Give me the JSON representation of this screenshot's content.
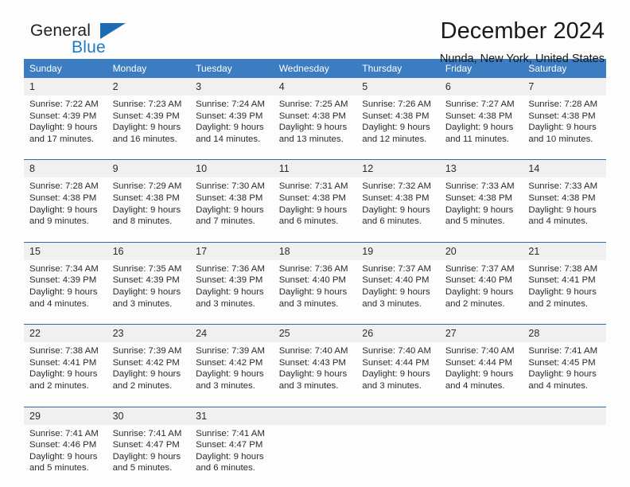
{
  "brand": {
    "name_part1": "General",
    "name_part2": "Blue",
    "flag_icon": "triangle-flag-icon"
  },
  "header": {
    "title": "December 2024",
    "location": "Nunda, New York, United States"
  },
  "colors": {
    "header_blue": "#3b7dc0",
    "separator_blue": "#2d6ca8",
    "daynum_band": "#f0f0f0",
    "brand_blue": "#1f7ac4",
    "text": "#2b2b2b"
  },
  "weekdays": [
    "Sunday",
    "Monday",
    "Tuesday",
    "Wednesday",
    "Thursday",
    "Friday",
    "Saturday"
  ],
  "weeks": [
    [
      {
        "day": "1",
        "sunrise": "Sunrise: 7:22 AM",
        "sunset": "Sunset: 4:39 PM",
        "daylight1": "Daylight: 9 hours",
        "daylight2": "and 17 minutes."
      },
      {
        "day": "2",
        "sunrise": "Sunrise: 7:23 AM",
        "sunset": "Sunset: 4:39 PM",
        "daylight1": "Daylight: 9 hours",
        "daylight2": "and 16 minutes."
      },
      {
        "day": "3",
        "sunrise": "Sunrise: 7:24 AM",
        "sunset": "Sunset: 4:39 PM",
        "daylight1": "Daylight: 9 hours",
        "daylight2": "and 14 minutes."
      },
      {
        "day": "4",
        "sunrise": "Sunrise: 7:25 AM",
        "sunset": "Sunset: 4:38 PM",
        "daylight1": "Daylight: 9 hours",
        "daylight2": "and 13 minutes."
      },
      {
        "day": "5",
        "sunrise": "Sunrise: 7:26 AM",
        "sunset": "Sunset: 4:38 PM",
        "daylight1": "Daylight: 9 hours",
        "daylight2": "and 12 minutes."
      },
      {
        "day": "6",
        "sunrise": "Sunrise: 7:27 AM",
        "sunset": "Sunset: 4:38 PM",
        "daylight1": "Daylight: 9 hours",
        "daylight2": "and 11 minutes."
      },
      {
        "day": "7",
        "sunrise": "Sunrise: 7:28 AM",
        "sunset": "Sunset: 4:38 PM",
        "daylight1": "Daylight: 9 hours",
        "daylight2": "and 10 minutes."
      }
    ],
    [
      {
        "day": "8",
        "sunrise": "Sunrise: 7:28 AM",
        "sunset": "Sunset: 4:38 PM",
        "daylight1": "Daylight: 9 hours",
        "daylight2": "and 9 minutes."
      },
      {
        "day": "9",
        "sunrise": "Sunrise: 7:29 AM",
        "sunset": "Sunset: 4:38 PM",
        "daylight1": "Daylight: 9 hours",
        "daylight2": "and 8 minutes."
      },
      {
        "day": "10",
        "sunrise": "Sunrise: 7:30 AM",
        "sunset": "Sunset: 4:38 PM",
        "daylight1": "Daylight: 9 hours",
        "daylight2": "and 7 minutes."
      },
      {
        "day": "11",
        "sunrise": "Sunrise: 7:31 AM",
        "sunset": "Sunset: 4:38 PM",
        "daylight1": "Daylight: 9 hours",
        "daylight2": "and 6 minutes."
      },
      {
        "day": "12",
        "sunrise": "Sunrise: 7:32 AM",
        "sunset": "Sunset: 4:38 PM",
        "daylight1": "Daylight: 9 hours",
        "daylight2": "and 6 minutes."
      },
      {
        "day": "13",
        "sunrise": "Sunrise: 7:33 AM",
        "sunset": "Sunset: 4:38 PM",
        "daylight1": "Daylight: 9 hours",
        "daylight2": "and 5 minutes."
      },
      {
        "day": "14",
        "sunrise": "Sunrise: 7:33 AM",
        "sunset": "Sunset: 4:38 PM",
        "daylight1": "Daylight: 9 hours",
        "daylight2": "and 4 minutes."
      }
    ],
    [
      {
        "day": "15",
        "sunrise": "Sunrise: 7:34 AM",
        "sunset": "Sunset: 4:39 PM",
        "daylight1": "Daylight: 9 hours",
        "daylight2": "and 4 minutes."
      },
      {
        "day": "16",
        "sunrise": "Sunrise: 7:35 AM",
        "sunset": "Sunset: 4:39 PM",
        "daylight1": "Daylight: 9 hours",
        "daylight2": "and 3 minutes."
      },
      {
        "day": "17",
        "sunrise": "Sunrise: 7:36 AM",
        "sunset": "Sunset: 4:39 PM",
        "daylight1": "Daylight: 9 hours",
        "daylight2": "and 3 minutes."
      },
      {
        "day": "18",
        "sunrise": "Sunrise: 7:36 AM",
        "sunset": "Sunset: 4:40 PM",
        "daylight1": "Daylight: 9 hours",
        "daylight2": "and 3 minutes."
      },
      {
        "day": "19",
        "sunrise": "Sunrise: 7:37 AM",
        "sunset": "Sunset: 4:40 PM",
        "daylight1": "Daylight: 9 hours",
        "daylight2": "and 3 minutes."
      },
      {
        "day": "20",
        "sunrise": "Sunrise: 7:37 AM",
        "sunset": "Sunset: 4:40 PM",
        "daylight1": "Daylight: 9 hours",
        "daylight2": "and 2 minutes."
      },
      {
        "day": "21",
        "sunrise": "Sunrise: 7:38 AM",
        "sunset": "Sunset: 4:41 PM",
        "daylight1": "Daylight: 9 hours",
        "daylight2": "and 2 minutes."
      }
    ],
    [
      {
        "day": "22",
        "sunrise": "Sunrise: 7:38 AM",
        "sunset": "Sunset: 4:41 PM",
        "daylight1": "Daylight: 9 hours",
        "daylight2": "and 2 minutes."
      },
      {
        "day": "23",
        "sunrise": "Sunrise: 7:39 AM",
        "sunset": "Sunset: 4:42 PM",
        "daylight1": "Daylight: 9 hours",
        "daylight2": "and 2 minutes."
      },
      {
        "day": "24",
        "sunrise": "Sunrise: 7:39 AM",
        "sunset": "Sunset: 4:42 PM",
        "daylight1": "Daylight: 9 hours",
        "daylight2": "and 3 minutes."
      },
      {
        "day": "25",
        "sunrise": "Sunrise: 7:40 AM",
        "sunset": "Sunset: 4:43 PM",
        "daylight1": "Daylight: 9 hours",
        "daylight2": "and 3 minutes."
      },
      {
        "day": "26",
        "sunrise": "Sunrise: 7:40 AM",
        "sunset": "Sunset: 4:44 PM",
        "daylight1": "Daylight: 9 hours",
        "daylight2": "and 3 minutes."
      },
      {
        "day": "27",
        "sunrise": "Sunrise: 7:40 AM",
        "sunset": "Sunset: 4:44 PM",
        "daylight1": "Daylight: 9 hours",
        "daylight2": "and 4 minutes."
      },
      {
        "day": "28",
        "sunrise": "Sunrise: 7:41 AM",
        "sunset": "Sunset: 4:45 PM",
        "daylight1": "Daylight: 9 hours",
        "daylight2": "and 4 minutes."
      }
    ],
    [
      {
        "day": "29",
        "sunrise": "Sunrise: 7:41 AM",
        "sunset": "Sunset: 4:46 PM",
        "daylight1": "Daylight: 9 hours",
        "daylight2": "and 5 minutes."
      },
      {
        "day": "30",
        "sunrise": "Sunrise: 7:41 AM",
        "sunset": "Sunset: 4:47 PM",
        "daylight1": "Daylight: 9 hours",
        "daylight2": "and 5 minutes."
      },
      {
        "day": "31",
        "sunrise": "Sunrise: 7:41 AM",
        "sunset": "Sunset: 4:47 PM",
        "daylight1": "Daylight: 9 hours",
        "daylight2": "and 6 minutes."
      },
      {
        "day": "",
        "sunrise": "",
        "sunset": "",
        "daylight1": "",
        "daylight2": ""
      },
      {
        "day": "",
        "sunrise": "",
        "sunset": "",
        "daylight1": "",
        "daylight2": ""
      },
      {
        "day": "",
        "sunrise": "",
        "sunset": "",
        "daylight1": "",
        "daylight2": ""
      },
      {
        "day": "",
        "sunrise": "",
        "sunset": "",
        "daylight1": "",
        "daylight2": ""
      }
    ]
  ]
}
